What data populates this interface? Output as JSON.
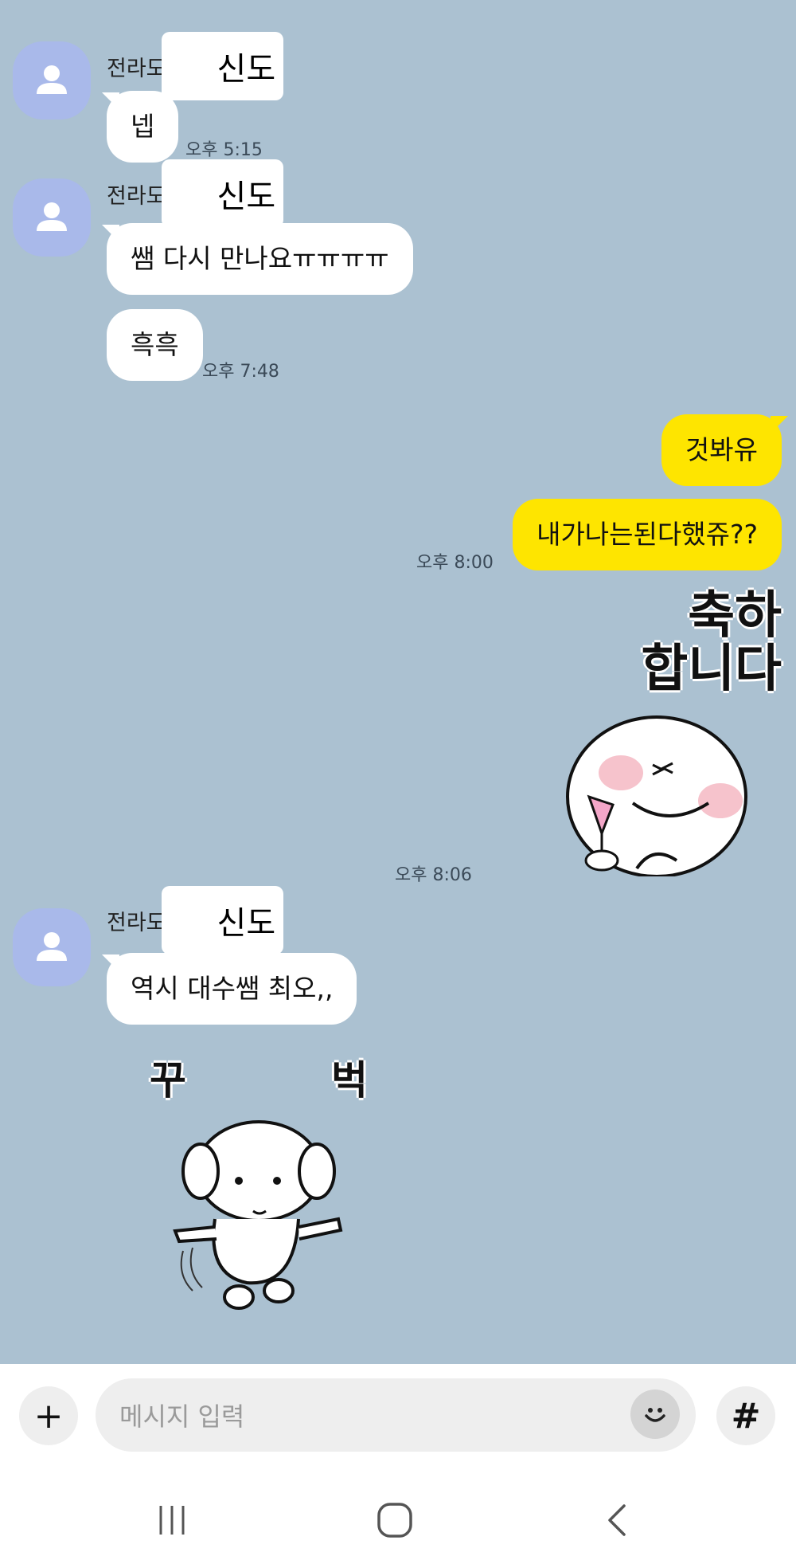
{
  "chat": {
    "sender_prefix": "전라도",
    "sender_name_visible": "신도",
    "messages": {
      "m1": "넵",
      "m2": "쌤 다시 만나요ㅠㅠㅠㅠ",
      "m3": "흑흑",
      "m4": "것봐유",
      "m5": "내가나는된다했쥬??",
      "m6": "역시 대수쌤 최오,,"
    },
    "times": {
      "t1": "오후 5:15",
      "t2": "오후 7:48",
      "t3": "오후 8:00",
      "t4": "오후 8:06"
    },
    "stickers": {
      "congrats_text": "축하\n합니다",
      "dog_text_left": "꾸",
      "dog_text_right": "벅"
    }
  },
  "input_bar": {
    "placeholder": "메시지 입력",
    "plus_label": "+",
    "hash_label": "#"
  },
  "icons": {
    "avatar": "person-icon",
    "emoji": "emoji-icon",
    "nav_recent": "recent-apps-icon",
    "nav_home": "home-icon",
    "nav_back": "back-icon"
  },
  "colors": {
    "background": "#abc1d1",
    "my_bubble": "#fee500",
    "their_bubble": "#ffffff",
    "avatar": "#a9b9ea"
  }
}
